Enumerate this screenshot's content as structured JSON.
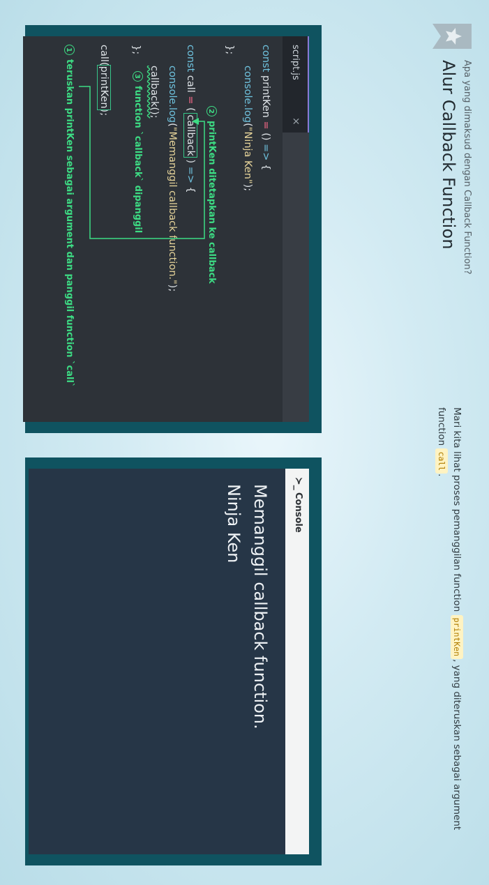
{
  "header": {
    "subtitle": "Apa yang dimaksud dengan Callback Function?",
    "title": "Alur Callback Function",
    "bookmark_icon": "star-bookmark-icon"
  },
  "description": {
    "part1": "Mari kita lihat proses pemanggilan function",
    "chip1": "printKen",
    "part2": ", yang diteruskan sebagai argument function",
    "chip2": "call",
    "part3": "."
  },
  "editor": {
    "tab_label": "script.js",
    "tab_close": "×",
    "lines": {
      "l1_kw": "const",
      "l1_name": " printKen ",
      "l1_eq": "=",
      "l1_rest": " () ",
      "l1_arrow": "=>",
      "l1_brace": " {",
      "l2_fn": "console.log",
      "l2_open": "(",
      "l2_str": "\"Ninja Ken\"",
      "l2_close": ");",
      "l3": "};",
      "l4_kw": "const",
      "l4_name": " call ",
      "l4_eq": "=",
      "l4_open": " ( ",
      "l4_param": "callback",
      "l4_close": " ) ",
      "l4_arrow": "=>",
      "l4_brace": " {",
      "l5_fn": "console.log",
      "l5_open": "(",
      "l5_str": "\"Memanggil callback function.\"",
      "l5_close": ");",
      "l6": "callback();",
      "l7": "};",
      "l8_call": "call(",
      "l8_arg": "printKen",
      "l8_end": ");"
    },
    "annotations": {
      "a1_num": "1",
      "a1_text": "teruskan printKen sebagai argument dan panggil function `call`",
      "a2_num": "2",
      "a2_text": "printKen ditetapkan ke callback",
      "a3_num": "3",
      "a3_text": "function `callback` dipanggil"
    },
    "colors": {
      "keyword": "#6fc3df",
      "operator": "#ff6b8b",
      "string": "#e6d49a",
      "annotation": "#3ddc84"
    }
  },
  "console": {
    "icon": "terminal-prompt-icon",
    "icon_glyph": "≻_",
    "title": "Console",
    "output": [
      "Memanggil callback function.",
      "Ninja Ken"
    ]
  }
}
